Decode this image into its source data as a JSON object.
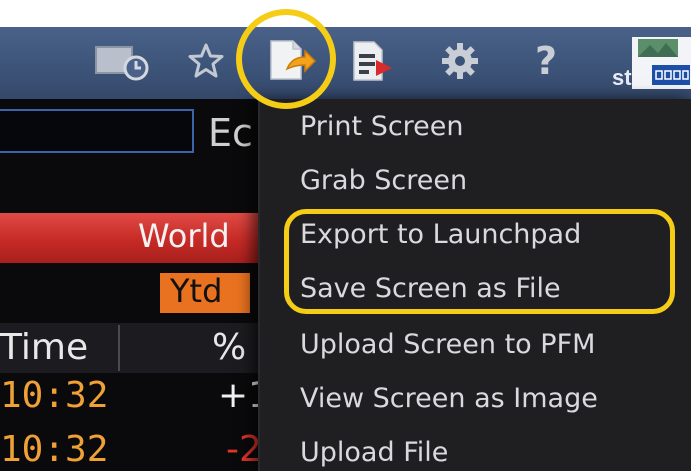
{
  "toolbar": {
    "icons": [
      "clock-icon",
      "star-icon",
      "export-page-icon",
      "report-icon",
      "gear-icon",
      "help-icon",
      "app-launcher-icon"
    ],
    "help_glyph": "?",
    "partial_label": "st"
  },
  "background": {
    "header_partial": "Ec",
    "banner_partial": "World",
    "period_chip": "Ytd",
    "columns": {
      "time": "Time",
      "change_partial": "%"
    },
    "rows": [
      {
        "time": "10:32",
        "change": "+1",
        "change_color": "#f2f2f2"
      },
      {
        "time": "10:32",
        "change": "-2",
        "change_color": "#e0352b"
      }
    ]
  },
  "menu": {
    "items": [
      "Print Screen",
      "Grab Screen",
      "Export to Launchpad",
      "Save Screen as File",
      "Upload Screen to PFM",
      "View Screen as Image",
      "Upload File"
    ]
  },
  "colors": {
    "highlight": "#f5cd16",
    "toolbar": "#3c5378",
    "menu_bg": "#1f1f22",
    "time_text": "#f0a135"
  }
}
